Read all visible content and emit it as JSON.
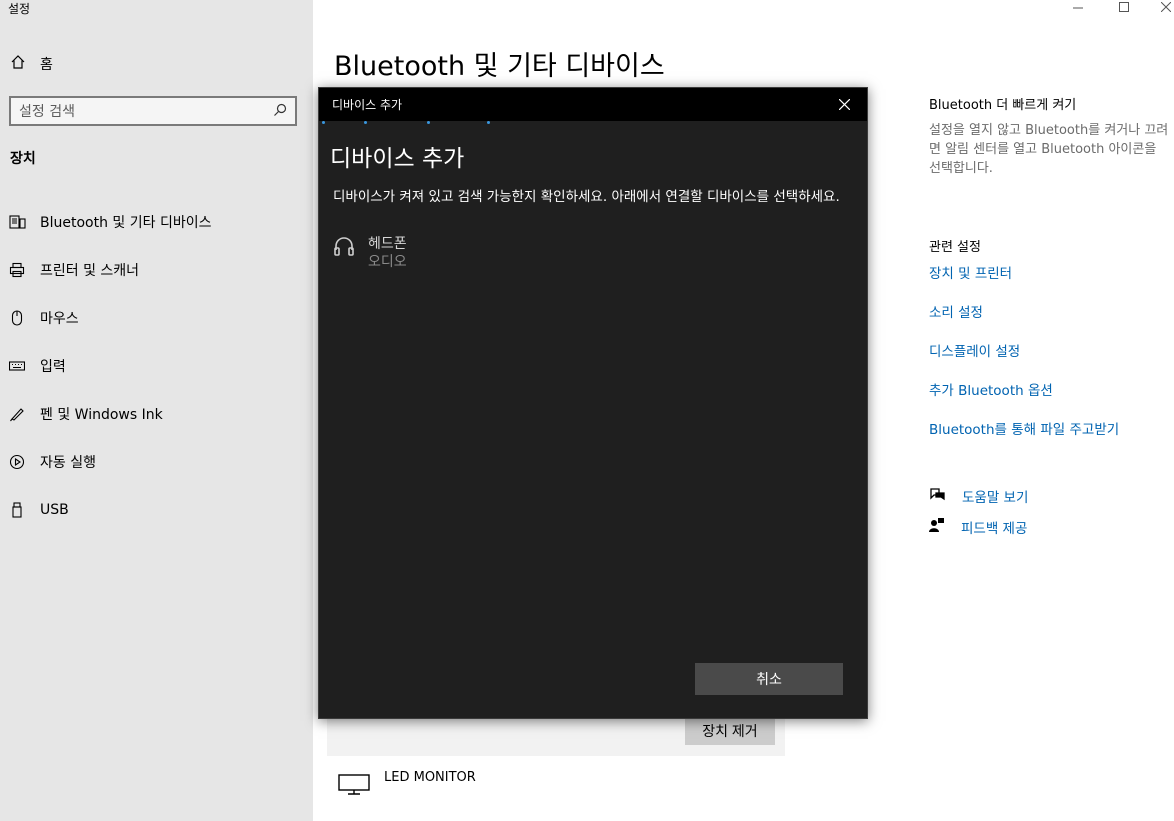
{
  "app": {
    "title": "설정"
  },
  "sidebar": {
    "home_label": "홈",
    "search_placeholder": "설정 검색",
    "section_label": "장치",
    "items": [
      {
        "label": "Bluetooth 및 기타 디바이스",
        "icon": "bluetooth-devices-icon"
      },
      {
        "label": "프린터 및 스캐너",
        "icon": "printer-icon"
      },
      {
        "label": "마우스",
        "icon": "mouse-icon"
      },
      {
        "label": "입력",
        "icon": "keyboard-icon"
      },
      {
        "label": "펜 및 Windows Ink",
        "icon": "pen-icon"
      },
      {
        "label": "자동 실행",
        "icon": "autoplay-icon"
      },
      {
        "label": "USB",
        "icon": "usb-icon"
      }
    ]
  },
  "main": {
    "title": "Bluetooth 및 기타 디바이스",
    "remove_button": "장치 제거",
    "device_led": "LED MONITOR"
  },
  "right": {
    "tip_heading": "Bluetooth 더 빠르게 켜기",
    "tip_text": "설정을 열지 않고 Bluetooth를 켜거나 끄려면 알림 센터를 열고 Bluetooth 아이콘을 선택합니다.",
    "related_heading": "관련 설정",
    "links": [
      "장치 및 프린터",
      "소리 설정",
      "디스플레이 설정",
      "추가 Bluetooth 옵션",
      "Bluetooth를 통해 파일 주고받기"
    ],
    "help": "도움말 보기",
    "feedback": "피드백 제공"
  },
  "dialog": {
    "window_title": "디바이스 추가",
    "heading": "디바이스 추가",
    "description": "디바이스가 켜져 있고 검색 가능한지 확인하세요. 아래에서 연결할 디바이스를 선택하세요.",
    "device": {
      "name": "헤드폰",
      "type": "오디오",
      "icon": "headphones-icon"
    },
    "cancel_button": "취소"
  },
  "colors": {
    "link": "#0063b1",
    "accent": "#3a96dd",
    "dialog_bg": "#1f1f1f",
    "sidebar_bg": "#e6e6e6"
  }
}
